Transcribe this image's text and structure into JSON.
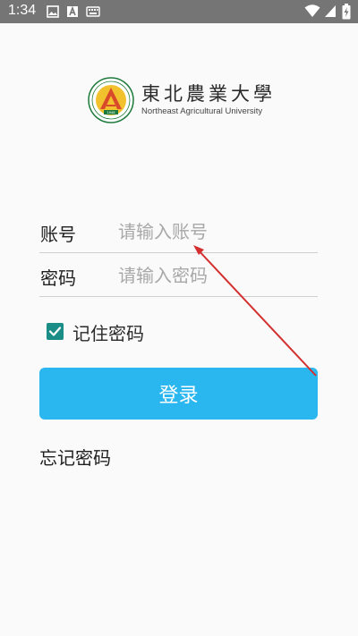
{
  "status_bar": {
    "time": "1:34",
    "left_icons": [
      "image-icon",
      "text-a-icon",
      "keyboard-icon"
    ],
    "right_icons": [
      "wifi-icon",
      "signal-icon",
      "battery-charging-icon"
    ],
    "background": "#757575"
  },
  "logo": {
    "name_cn": "東北農業大學",
    "name_en": "Northeast Agricultural University",
    "emblem_letter": "A",
    "emblem_year": "1948",
    "emblem_color": "#1e7a3c",
    "emblem_ring_color": "#d94a2a"
  },
  "form": {
    "account": {
      "label": "账号",
      "value": "",
      "placeholder": "请输入账号"
    },
    "password": {
      "label": "密码",
      "value": "",
      "placeholder": "请输入密码"
    },
    "remember": {
      "label": "记住密码",
      "checked": true,
      "color": "#1a8d86"
    },
    "login_button": {
      "label": "登录",
      "color": "#2ab7f0"
    },
    "forgot_password": "忘记密码"
  },
  "annotation": {
    "type": "arrow",
    "color": "#d32f2f"
  }
}
